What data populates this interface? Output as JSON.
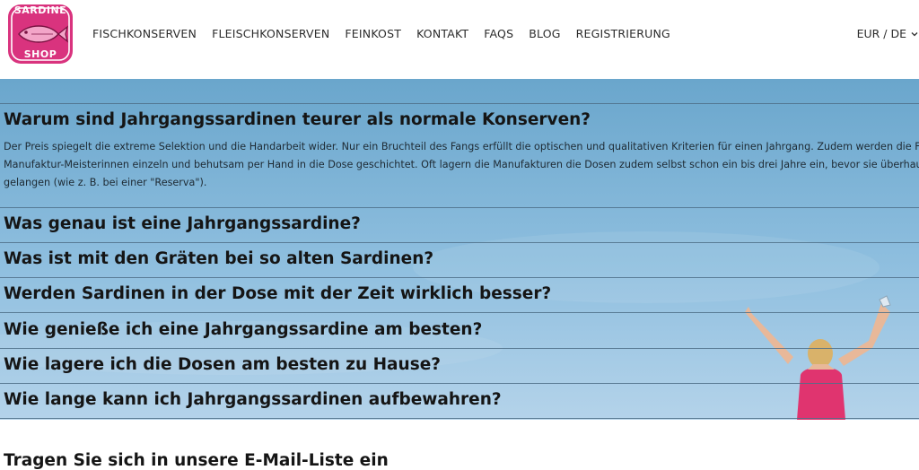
{
  "logo": {
    "top_text": "SARDINE",
    "bottom_text": "SHOP"
  },
  "nav": [
    "FISCHKONSERVEN",
    "FLEISCHKONSERVEN",
    "FEINKOST",
    "KONTAKT",
    "FAQS",
    "BLOG",
    "REGISTRIERUNG"
  ],
  "locale": "EUR / DE",
  "faq": {
    "open": {
      "question": "Warum sind Jahrgangssardinen teurer als normale Konserven?",
      "answer_lines": [
        "Der Preis spiegelt die extreme Selektion und die Handarbeit wider. Nur ein Bruchteil des Fangs erfüllt die optischen und qualitativen Kriterien für einen Jahrgang. Zudem werden die Fisch",
        "Manufaktur-Meisterinnen einzeln und behutsam per Hand in die Dose geschichtet. Oft lagern die Manufakturen die Dosen zudem selbst schon ein bis drei Jahre ein, bevor sie überhaupt i",
        "gelangen (wie z. B. bei einer \"Reserva\")."
      ]
    },
    "questions": [
      "Was genau ist eine Jahrgangssardine?",
      "Was ist mit den Gräten bei so alten Sardinen?",
      "Werden Sardinen in der Dose mit der Zeit wirklich besser?",
      "Wie genieße ich eine Jahrgangssardine am besten?",
      "Wie lagere ich die Dosen am besten zu Hause?",
      "Wie lange kann ich Jahrgangssardinen aufbewahren?"
    ]
  },
  "newsletter": {
    "title": "Tragen Sie sich in unsere E-Mail-Liste ein"
  },
  "colors": {
    "brand_pink": "#d9337e",
    "hero_sky": "#7fb4d6"
  }
}
